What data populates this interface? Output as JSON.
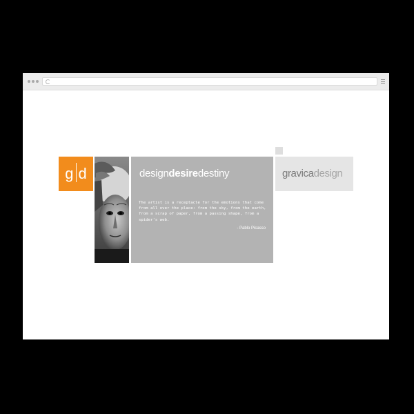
{
  "logo": {
    "left": "g",
    "right": "d",
    "bg_color": "#f28c1c"
  },
  "tagline": {
    "part1": "design",
    "part2": "desire",
    "part3": "destiny"
  },
  "quote": {
    "text": "The artist is a receptacle for the emotions that come from all over the place: from the sky, from the earth, from a scrap of paper, from a passing shape, from a spider's web.",
    "author": "- Pablo Picasso"
  },
  "brand": {
    "part1": "gravica",
    "part2": "design"
  },
  "icons": {
    "window_controls": "window-dots-icon",
    "reload": "reload-icon",
    "menu": "menu-icon",
    "portrait": "portrait-image"
  }
}
